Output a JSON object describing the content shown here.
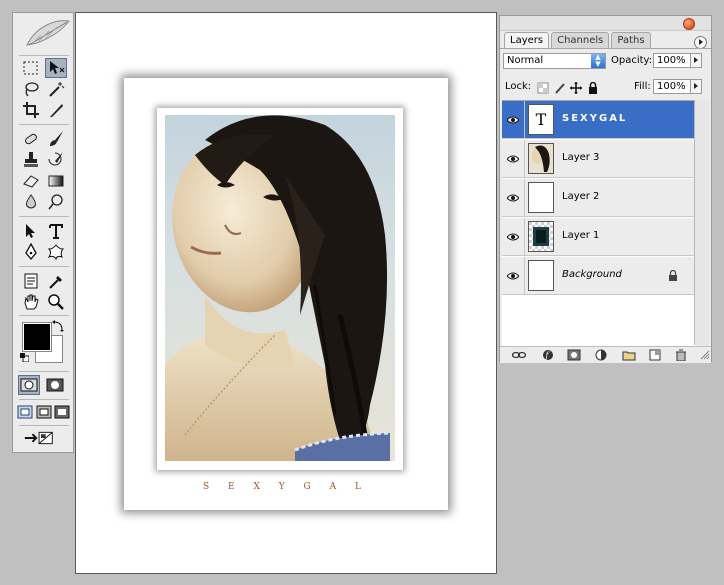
{
  "toolbox": {
    "icons": [
      "feather-logo-icon",
      "marquee-tool-icon",
      "move-tool-icon",
      "lasso-tool-icon",
      "magic-wand-tool-icon",
      "crop-tool-icon",
      "slice-tool-icon",
      "healing-brush-tool-icon",
      "brush-tool-icon",
      "clone-stamp-tool-icon",
      "history-brush-tool-icon",
      "eraser-tool-icon",
      "gradient-tool-icon",
      "blur-tool-icon",
      "dodge-tool-icon",
      "path-selection-tool-icon",
      "type-tool-icon",
      "pen-tool-icon",
      "shape-tool-icon",
      "notes-tool-icon",
      "eyedropper-tool-icon",
      "hand-tool-icon",
      "zoom-tool-icon",
      "swap-colors-icon",
      "default-colors-icon",
      "standard-mode-icon",
      "quick-mask-mode-icon",
      "standard-screen-mode-icon",
      "full-screen-menu-mode-icon",
      "full-screen-mode-icon",
      "jump-to-imageready-icon"
    ],
    "foreground_color": "#000000",
    "background_color": "#ffffff",
    "active_tool": "move-tool-icon"
  },
  "document": {
    "caption": "S E X Y G A L",
    "caption_color": "#a0522d"
  },
  "layers_panel": {
    "tabs": [
      "Layers",
      "Channels",
      "Paths"
    ],
    "active_tab": "Layers",
    "blend_mode": "Normal",
    "opacity_label": "Opacity:",
    "opacity_value": "100%",
    "lock_label": "Lock:",
    "fill_label": "Fill:",
    "fill_value": "100%",
    "layers": [
      {
        "name": "SEXYGAL",
        "thumb": "T",
        "selected": true
      },
      {
        "name": "Layer 3",
        "selected": false
      },
      {
        "name": "Layer 2",
        "selected": false
      },
      {
        "name": "Layer 1",
        "selected": false
      },
      {
        "name": "Background",
        "selected": false,
        "locked": true
      }
    ],
    "footer_icons": [
      "link-layers-icon",
      "layer-style-icon",
      "layer-mask-icon",
      "adjustment-layer-icon",
      "new-group-icon",
      "new-layer-icon",
      "delete-layer-icon"
    ],
    "selected_color": "#3a6ec6"
  }
}
